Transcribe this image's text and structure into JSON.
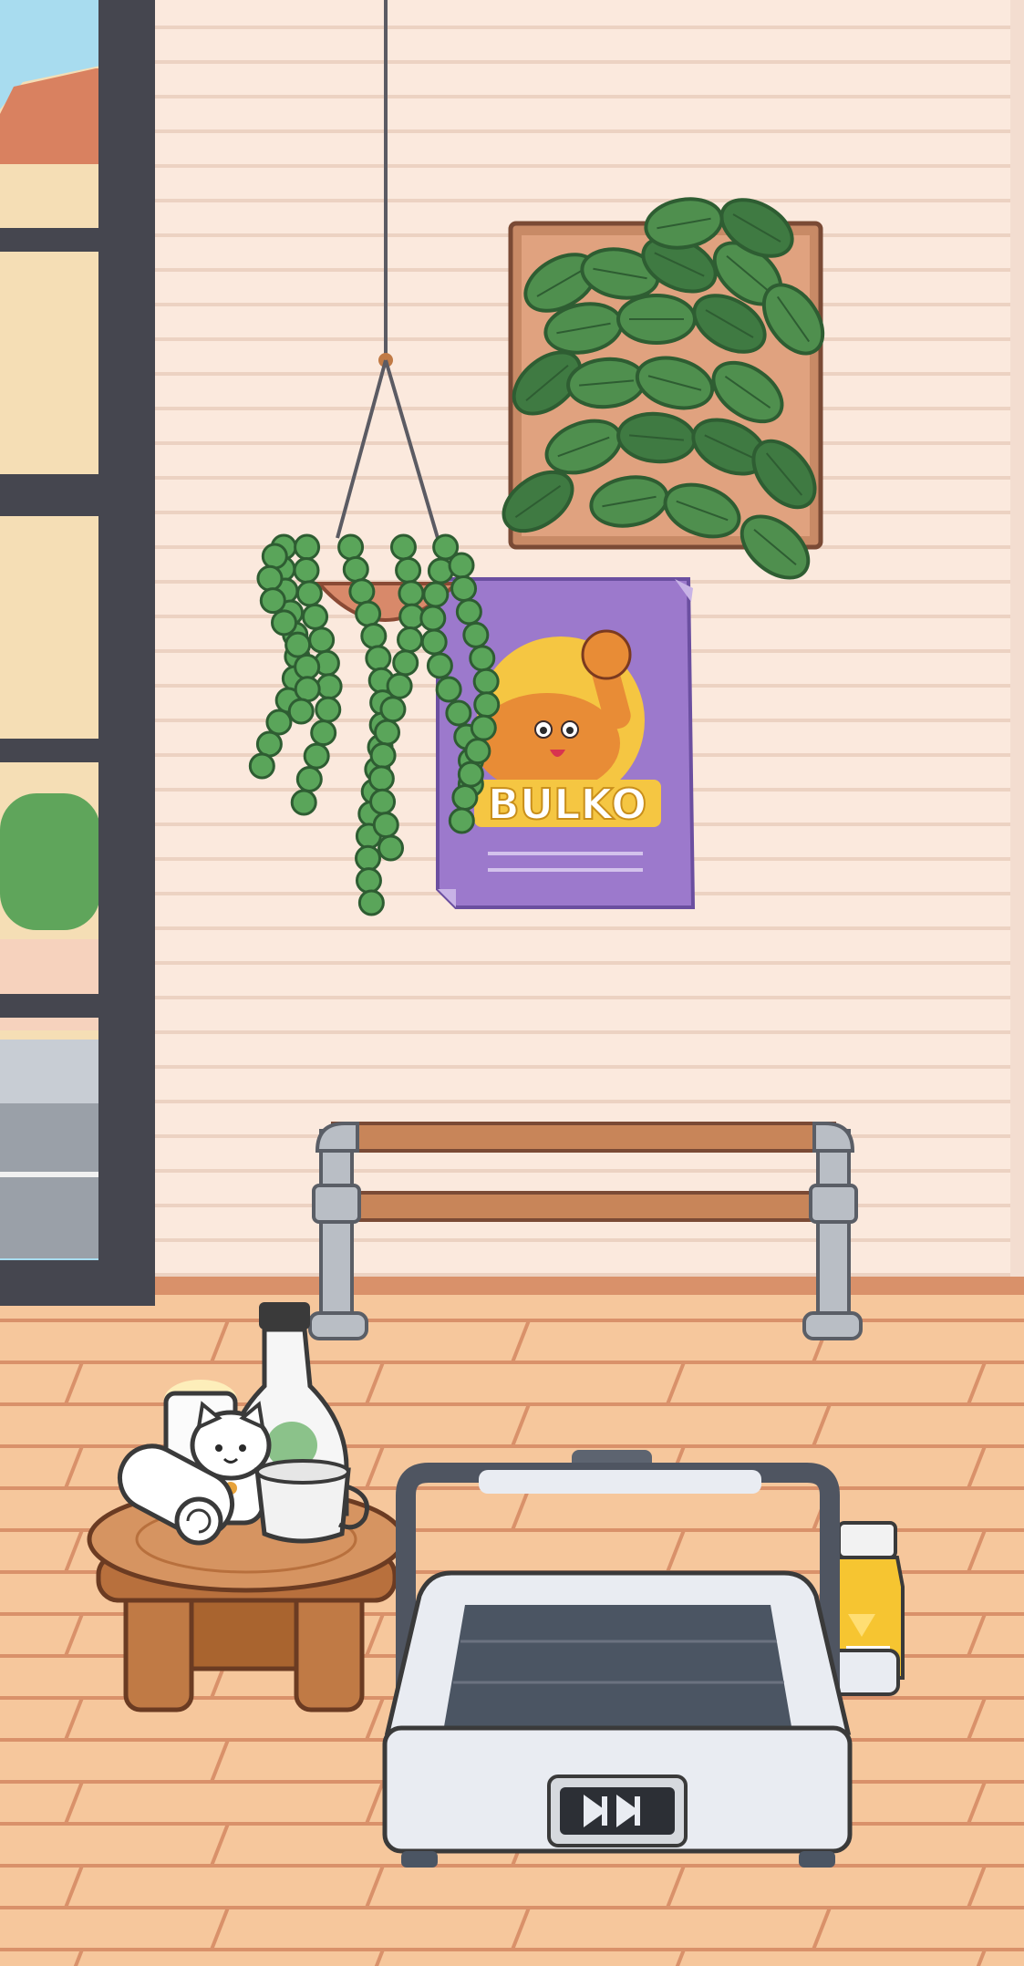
{
  "scene": {
    "room": "gym-corner",
    "colors": {
      "wall": "#fbe9dd",
      "wall_line": "#ecd2c2",
      "floor": "#f6c79c",
      "floor_line": "#d9916a",
      "window_frame": "#45464f",
      "sky": "#a8dcef",
      "poster": "#9c79cc",
      "poster_badge": "#f5c642",
      "leaf": "#4f8f4e",
      "leaf_dark": "#2e5d32",
      "wood": "#c07a45",
      "metal": "#b9bec5",
      "treadmill_body": "#e9ecf2",
      "treadmill_belt": "#4b5563",
      "juice": "#f6c531"
    }
  },
  "poster": {
    "title": "BULKO",
    "icon": "flexing-muscle-icon"
  },
  "treadmill": {
    "control_icon": "fast-forward-icon"
  },
  "items": [
    {
      "name": "hanging-pearl-plant",
      "icon": "plant-icon"
    },
    {
      "name": "wall-fern-frame",
      "icon": "fern-icon"
    },
    {
      "name": "ballet-barre",
      "icon": "barre-icon"
    },
    {
      "name": "wooden-stool",
      "icon": "stool-icon"
    },
    {
      "name": "water-bottle",
      "icon": "bottle-icon"
    },
    {
      "name": "cat-figurine",
      "icon": "cat-icon"
    },
    {
      "name": "towel-roll",
      "icon": "towel-icon"
    },
    {
      "name": "candle",
      "icon": "candle-icon"
    },
    {
      "name": "tea-cup",
      "icon": "cup-icon"
    },
    {
      "name": "juice-bottle",
      "icon": "juice-icon"
    }
  ]
}
